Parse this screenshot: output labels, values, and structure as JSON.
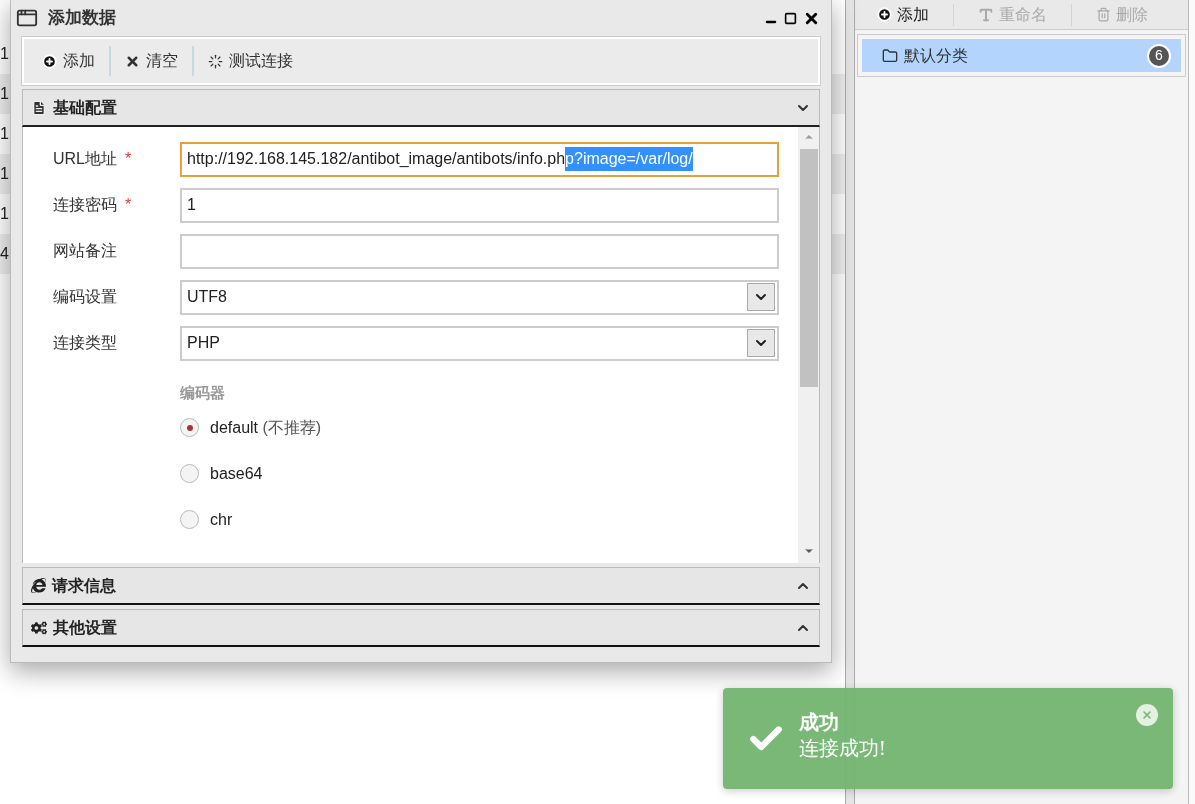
{
  "background_list": {
    "cells": [
      "1",
      "1",
      "1",
      "1",
      "1",
      "4"
    ]
  },
  "side_panel": {
    "toolbar": [
      {
        "label": "添加",
        "disabled": false
      },
      {
        "label": "重命名",
        "disabled": true
      },
      {
        "label": "删除",
        "disabled": true
      }
    ],
    "items": [
      {
        "label": "默认分类",
        "count": "6",
        "selected": true
      }
    ]
  },
  "dialog": {
    "title": "添加数据",
    "toolbar": [
      {
        "label": "添加"
      },
      {
        "label": "清空"
      },
      {
        "label": "测试连接"
      }
    ],
    "sections": [
      {
        "title": "基础配置",
        "expanded": true
      },
      {
        "title": "请求信息",
        "expanded": false
      },
      {
        "title": "其他设置",
        "expanded": false
      }
    ],
    "fields": [
      {
        "kind": "text",
        "label": "URL地址",
        "required_mark": "*",
        "focused": true,
        "value": "http://192.168.145.182/antibot_image/antibots/info.ph",
        "selected_text": "p?image=/var/log/"
      },
      {
        "kind": "text",
        "label": "连接密码",
        "required_mark": "*",
        "focused": false,
        "value": "1"
      },
      {
        "kind": "text",
        "label": "网站备注",
        "focused": false
      },
      {
        "kind": "select",
        "label": "编码设置",
        "value": "UTF8"
      },
      {
        "kind": "select",
        "label": "连接类型",
        "value": "PHP"
      }
    ],
    "encoder": {
      "title": "编码器",
      "options": [
        {
          "label": "default",
          "note": "(不推荐)",
          "selected": true
        },
        {
          "label": "base64",
          "selected": false
        },
        {
          "label": "chr",
          "selected": false
        }
      ]
    }
  },
  "toast": {
    "title": "成功",
    "message": "连接成功!"
  }
}
